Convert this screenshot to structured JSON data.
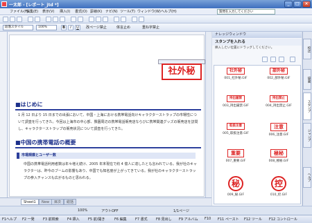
{
  "window": {
    "title": "一太郎 - [レポート_jtd *]"
  },
  "menubar": {
    "items": [
      "ファイル(F)",
      "編集(E)",
      "表示(V)",
      "挿入(I)",
      "書式(O)",
      "罫線(K)",
      "ナビ(N)",
      "ツール(T)",
      "ウィンドウ(W)",
      "ヘルプ(H)"
    ],
    "question_placeholder": "質問を入力してください"
  },
  "toolbar": {
    "zoom": "100%",
    "b_label": "B",
    "i_label": "I",
    "u_label": "U",
    "spell_label": "校正",
    "style_label": "段落スタイル",
    "kinsoku_label": "改ページ禁止",
    "taigen_label": "体言止め",
    "juten_label": "重ね字禁止"
  },
  "document": {
    "heading1": "■はじめに",
    "para1": "1 月 12 日より 15 日までの出張において、中国・上海における携帯電話向けキャラクターストラップの市場性について調査を行ってきた。今回は上海市の中心部、豫園周辺の携帯電話販売店ならびに携帯関連グッズの販売店を訪問し、キャラクターストラップの販売状況について調査を行ってきた。",
    "heading2": "■中国の携帯電話の概要",
    "subheading": "市場規模とユーザー数",
    "para2": "中国の携帯電話利用者数は年々増え続け、2005 年末現在で約 4 億人に達したとも言われている。我が社のキャラクターは、昨今のブームの影響もあり、中国でも知名度が上がってきている。我が社のキャラクターストラップの参入チャンスも広がるものと思われる。",
    "stamp_text": "社外秘"
  },
  "sheet_tabs": [
    "Sheet1",
    "New",
    "目次",
    "総括"
  ],
  "panel": {
    "header": "ナレッジウィンドウ",
    "title": "スタンプを入れる",
    "hint": "挿入したい位置にドラッグしてください。",
    "stamps": [
      {
        "text": "社外秘",
        "caption": "001_社外秘.GIF",
        "round": false
      },
      {
        "text": "部外秘",
        "caption": "002_部外秘.GIF",
        "round": false
      },
      {
        "text": "持出厳禁",
        "caption": "003_持出厳禁.GIF",
        "round": false
      },
      {
        "text": "持出禁止",
        "caption": "004_持出禁止.GIF",
        "round": false
      },
      {
        "text": "取扱注意",
        "caption": "005_取扱注意.GIF",
        "round": false
      },
      {
        "text": "注意",
        "caption": "006_注意.GIF",
        "round": false
      },
      {
        "text": "重要",
        "caption": "007_重要.GIF",
        "round": false
      },
      {
        "text": "極秘",
        "caption": "008_極秘.GIF",
        "round": false
      },
      {
        "text": "秘",
        "caption": "009_秘.GIF",
        "round": true
      },
      {
        "text": "控",
        "caption": "010_控.GIF",
        "round": true
      }
    ]
  },
  "side_tabs": [
    "校正",
    "辞書",
    "スタンプ",
    "ジャンプ",
    "ヘルプ"
  ],
  "status": {
    "items": [
      "F1ヘルプ",
      "F2 一発",
      "F3 前検索",
      "F4 挿入",
      "F5 前/開き",
      "F6 編集",
      "F7 書式",
      "F8 見出し",
      "F9 アルバム",
      "F10",
      "F11 ペースト",
      "F12 ツール",
      "F12 コントロール"
    ],
    "page_info": "1/1ページ",
    "mode": "アウトOFF",
    "zoom": "100%"
  },
  "colors": {
    "accent": "#2c3f9c",
    "stamp_red": "#d22222",
    "titlebar": "#3d6fbf"
  }
}
